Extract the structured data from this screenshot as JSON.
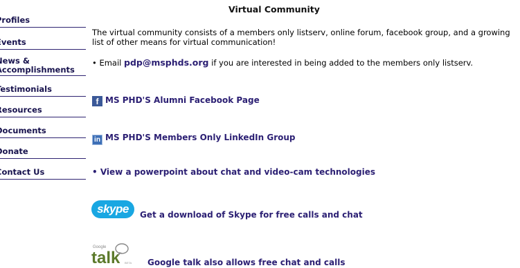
{
  "nav": {
    "items": [
      {
        "label": "Profiles"
      },
      {
        "label": "Events"
      },
      {
        "label": "News & Accomplishments"
      },
      {
        "label": "Testimonials"
      },
      {
        "label": "Resources"
      },
      {
        "label": "Documents"
      },
      {
        "label": "Donate"
      },
      {
        "label": "Contact Us"
      }
    ]
  },
  "main": {
    "title": "Virtual Community",
    "intro": "The virtual community consists of a members only listserv, online forum, facebook group, and a growing list of other means for virtual communication!",
    "email_prefix": "• Email ",
    "email": "pdp@msphds.org",
    "email_suffix": " if you are interested in being added to the members only listserv.",
    "links": {
      "facebook": "MS PHD'S Alumni Facebook Page",
      "linkedin": "MS PHD'S Members Only LinkedIn Group",
      "powerpoint": "• View a powerpoint about chat and video-cam technologies",
      "skype": "Get a download of Skype for free calls and chat",
      "gtalk": "Google talk also allows free chat and calls"
    },
    "logos": {
      "skype": "skype",
      "gtalk_small": "Google",
      "gtalk_big": "talk",
      "gtalk_beta": "BETA"
    },
    "colors": {
      "link": "#2b1f73",
      "nav_border": "#2d2270",
      "facebook": "#3b5998",
      "skype": "#19a7e2"
    }
  }
}
